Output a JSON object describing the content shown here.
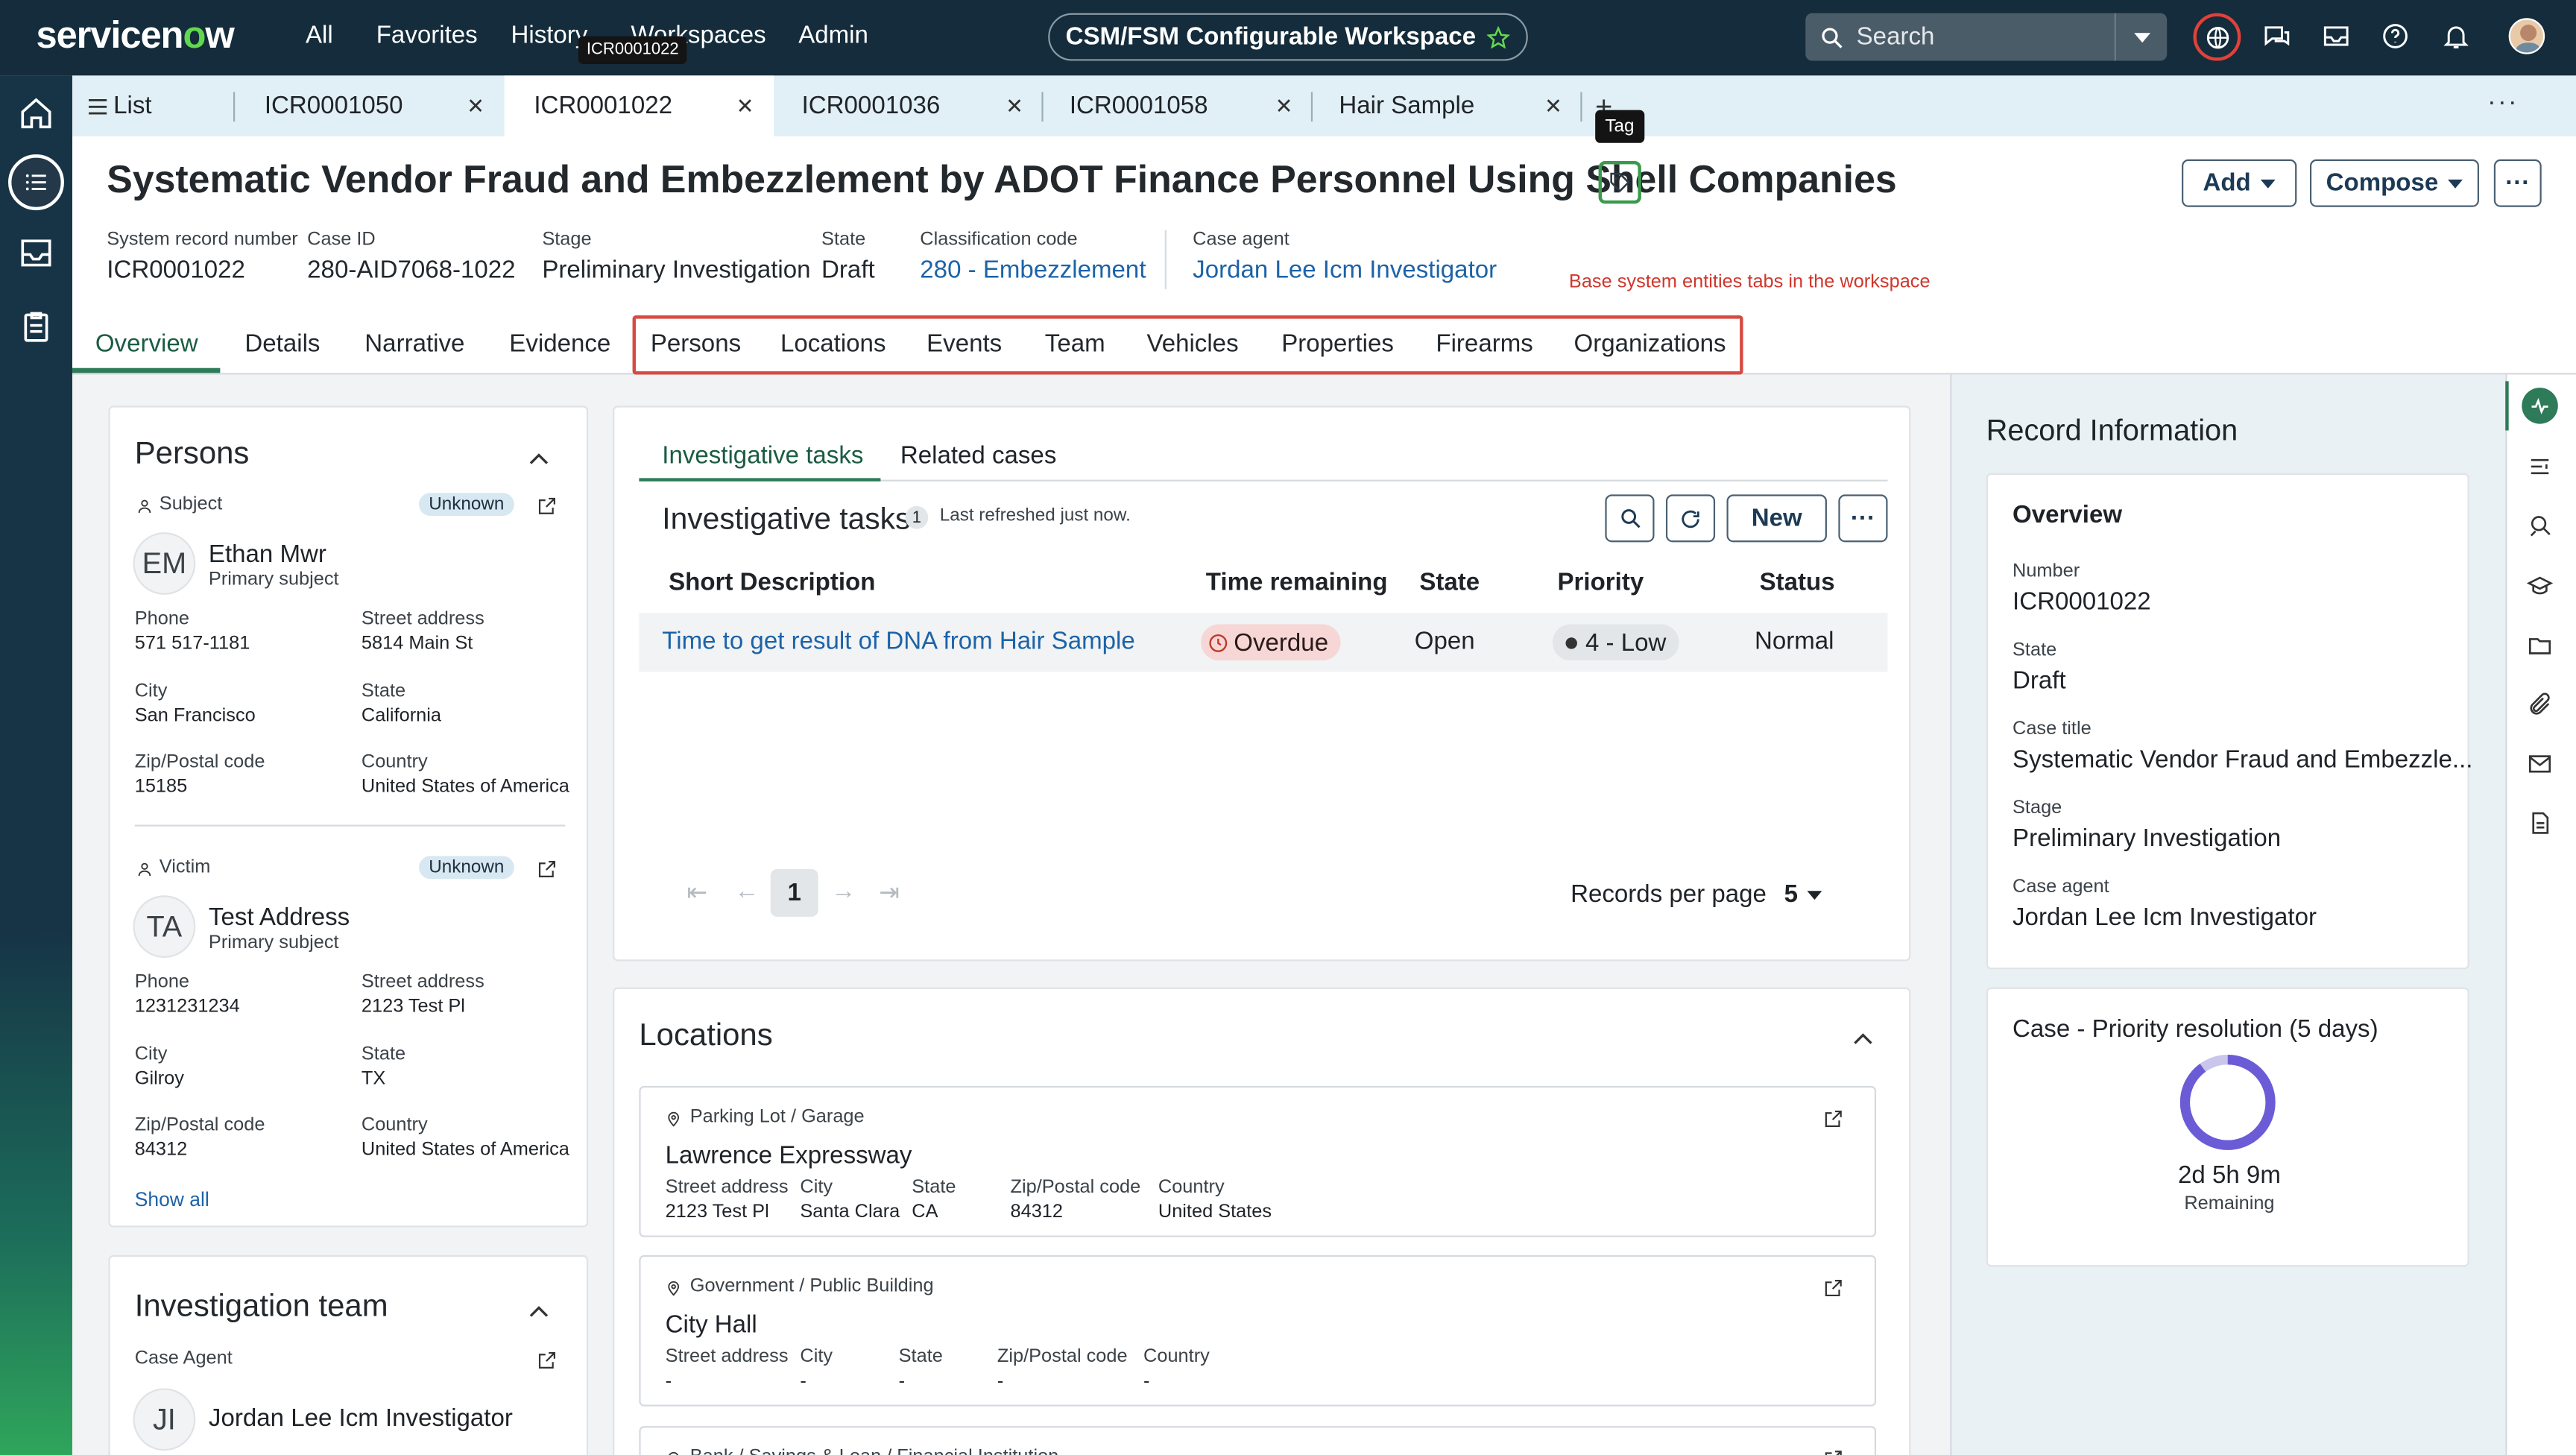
{
  "topbar": {
    "logo": "servicenow",
    "nav": [
      "All",
      "Favorites",
      "History",
      "Workspaces",
      "Admin"
    ],
    "workspace": "CSM/FSM Configurable Workspace",
    "search_placeholder": "Search",
    "hover_tooltip": "ICR0001022"
  },
  "tabs": [
    {
      "label": "List"
    },
    {
      "label": "ICR0001050"
    },
    {
      "label": "ICR0001022"
    },
    {
      "label": "ICR0001036"
    },
    {
      "label": "ICR0001058"
    },
    {
      "label": "Hair Sample"
    }
  ],
  "tag_tooltip": "Tag",
  "header": {
    "title": "Systematic Vendor Fraud and Embezzlement by ADOT Finance Personnel Using Shell Companies",
    "add": "Add",
    "compose": "Compose",
    "fields": [
      {
        "label": "System record number",
        "value": "ICR0001022"
      },
      {
        "label": "Case ID",
        "value": "280-AID7068-1022"
      },
      {
        "label": "Stage",
        "value": "Preliminary Investigation"
      },
      {
        "label": "State",
        "value": "Draft"
      },
      {
        "label": "Classification code",
        "value": "280 - Embezzlement"
      },
      {
        "label": "Case agent",
        "value": "Jordan Lee Icm Investigator"
      }
    ],
    "annotation": "Base system entities tabs in the workspace"
  },
  "record_tabs": [
    "Overview",
    "Details",
    "Narrative",
    "Evidence",
    "Persons",
    "Locations",
    "Events",
    "Team",
    "Vehicles",
    "Properties",
    "Firearms",
    "Organizations"
  ],
  "persons": {
    "title": "Persons",
    "show_all": "Show all",
    "list": [
      {
        "role": "Subject",
        "badge": "Unknown",
        "initials": "EM",
        "name": "Ethan Mwr",
        "sub": "Primary subject",
        "phone_l": "Phone",
        "phone": "571 517-1181",
        "street_l": "Street address",
        "street": "5814 Main St",
        "city_l": "City",
        "city": "San Francisco",
        "state_l": "State",
        "state": "California",
        "zip_l": "Zip/Postal code",
        "zip": "15185",
        "country_l": "Country",
        "country": "United States of America"
      },
      {
        "role": "Victim",
        "badge": "Unknown",
        "initials": "TA",
        "name": "Test Address",
        "sub": "Primary subject",
        "phone_l": "Phone",
        "phone": "1231231234",
        "street_l": "Street address",
        "street": "2123 Test Pl",
        "city_l": "City",
        "city": "Gilroy",
        "state_l": "State",
        "state": "TX",
        "zip_l": "Zip/Postal code",
        "zip": "84312",
        "country_l": "Country",
        "country": "United States of America"
      }
    ]
  },
  "team": {
    "title": "Investigation team",
    "role": "Case Agent",
    "initials": "JI",
    "name": "Jordan Lee Icm Investigator"
  },
  "tasks": {
    "tab1": "Investigative tasks",
    "tab2": "Related cases",
    "title": "Investigative tasks",
    "count": "1",
    "refreshed": "Last refreshed just now.",
    "new": "New",
    "columns": [
      "Short Description",
      "Time remaining",
      "State",
      "Priority",
      "Status"
    ],
    "row": {
      "desc": "Time to get result of DNA from Hair Sample",
      "time": "Overdue",
      "state": "Open",
      "priority": "4 - Low",
      "status": "Normal"
    },
    "page": "1",
    "rpp_label": "Records per page",
    "rpp": "5"
  },
  "locations": {
    "title": "Locations",
    "items": [
      {
        "type": "Parking Lot / Garage",
        "name": "Lawrence Expressway",
        "labels": [
          "Street address",
          "City",
          "State",
          "Zip/Postal code",
          "Country"
        ],
        "values": [
          "2123 Test Pl",
          "Santa Clara",
          "CA",
          "84312",
          "United States"
        ]
      },
      {
        "type": "Government / Public Building",
        "name": "City Hall",
        "labels": [
          "Street address",
          "City",
          "State",
          "Zip/Postal code",
          "Country"
        ],
        "values": [
          "-",
          "-",
          "-",
          "-",
          "-"
        ]
      },
      {
        "type": "Bank / Savings & Loan / Financial Institution"
      }
    ]
  },
  "record_info": {
    "title": "Record Information",
    "overview": "Overview",
    "fields": [
      {
        "label": "Number",
        "value": "ICR0001022"
      },
      {
        "label": "State",
        "value": "Draft"
      },
      {
        "label": "Case title",
        "value": "Systematic Vendor Fraud and Embezzle..."
      },
      {
        "label": "Stage",
        "value": "Preliminary Investigation"
      },
      {
        "label": "Case agent",
        "value": "Jordan Lee Icm Investigator"
      }
    ],
    "sla_title": "Case - Priority resolution (5 days)",
    "sla_time": "2d 5h 9m",
    "sla_sub": "Remaining",
    "sla_elapsed_fraction": 0.1
  },
  "colors": {
    "topbar": "#142c3b",
    "accent": "#2d7b58",
    "link": "#1c63a8",
    "overdue": "#c0392b"
  }
}
